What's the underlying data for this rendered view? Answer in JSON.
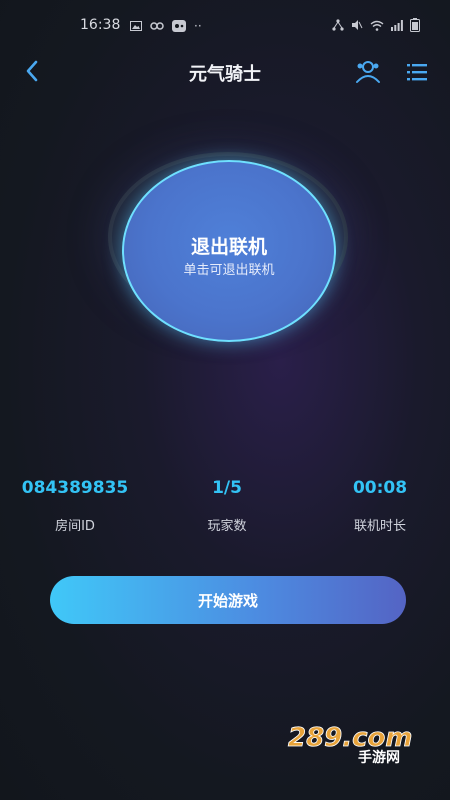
{
  "status_bar": {
    "time": "16:38",
    "left_icons": [
      "image-icon",
      "link-icon",
      "game-icon",
      "more-icon"
    ],
    "right_icons": [
      "network-icon",
      "mute-icon",
      "wifi-icon",
      "signal-icon",
      "battery-icon"
    ]
  },
  "header": {
    "title": "元气骑士"
  },
  "connect_button": {
    "title": "退出联机",
    "subtitle": "单击可退出联机"
  },
  "stats": {
    "room_id": {
      "value": "084389835",
      "label": "房间ID"
    },
    "players": {
      "value": "1/5",
      "label": "玩家数"
    },
    "duration": {
      "value": "00:08",
      "label": "联机时长"
    }
  },
  "start_button": {
    "label": "开始游戏"
  },
  "watermark": {
    "brand": "289.com",
    "sub": "手游网"
  },
  "colors": {
    "accent": "#33c3f5",
    "background": "#141820",
    "button_start": "#40c8f8",
    "button_end": "#5464c4",
    "header_icons": "#4aa8f0"
  }
}
